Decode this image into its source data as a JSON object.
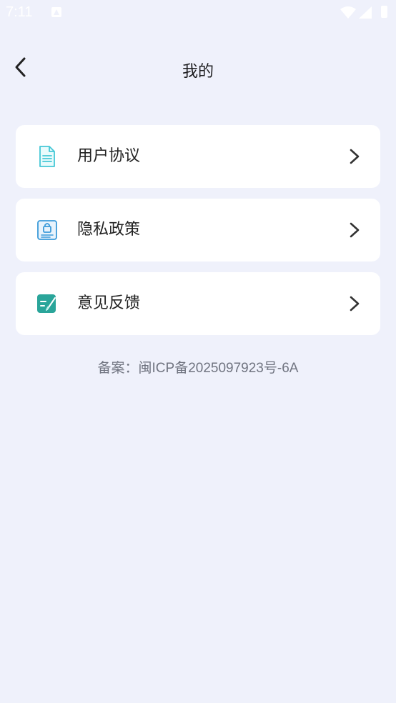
{
  "status_bar": {
    "time": "7:11",
    "icons": [
      "alert-icon",
      "wifi-icon",
      "signal-icon",
      "battery-icon"
    ]
  },
  "header": {
    "back_icon": "chevron-left-icon",
    "title": "我的"
  },
  "menu": [
    {
      "label": "用户协议",
      "icon": "document-icon",
      "icon_color": "#45c8d6"
    },
    {
      "label": "隐私政策",
      "icon": "privacy-lock-icon",
      "icon_color": "#3a9ad9"
    },
    {
      "label": "意见反馈",
      "icon": "feedback-edit-icon",
      "icon_color": "#2aa59a"
    }
  ],
  "footer": {
    "icp": "备案：闽ICP备2025097923号-6A"
  },
  "colors": {
    "background": "#eff1fb",
    "card": "#ffffff",
    "text": "#222222",
    "footer_text": "#707480"
  }
}
